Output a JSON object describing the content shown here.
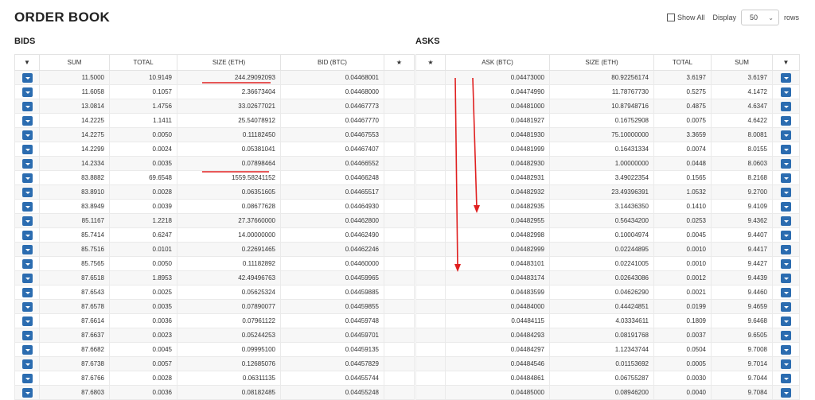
{
  "header": {
    "title": "ORDER BOOK"
  },
  "controls": {
    "show_all_label": "Show All",
    "display_label": "Display",
    "rows_value": "50",
    "rows_label": "rows"
  },
  "bids": {
    "title": "BIDS",
    "columns": [
      "▼",
      "SUM",
      "TOTAL",
      "SIZE (ETH)",
      "BID (BTC)",
      "★"
    ],
    "rows": [
      [
        "11.5000",
        "10.9149",
        "244.29092093",
        "0.04468001"
      ],
      [
        "11.6058",
        "0.1057",
        "2.36673404",
        "0.04468000"
      ],
      [
        "13.0814",
        "1.4756",
        "33.02677021",
        "0.04467773"
      ],
      [
        "14.2225",
        "1.1411",
        "25.54078912",
        "0.04467770"
      ],
      [
        "14.2275",
        "0.0050",
        "0.11182450",
        "0.04467553"
      ],
      [
        "14.2299",
        "0.0024",
        "0.05381041",
        "0.04467407"
      ],
      [
        "14.2334",
        "0.0035",
        "0.07898464",
        "0.04466552"
      ],
      [
        "83.8882",
        "69.6548",
        "1559.58241152",
        "0.04466248"
      ],
      [
        "83.8910",
        "0.0028",
        "0.06351605",
        "0.04465517"
      ],
      [
        "83.8949",
        "0.0039",
        "0.08677628",
        "0.04464930"
      ],
      [
        "85.1167",
        "1.2218",
        "27.37660000",
        "0.04462800"
      ],
      [
        "85.7414",
        "0.6247",
        "14.00000000",
        "0.04462490"
      ],
      [
        "85.7516",
        "0.0101",
        "0.22691465",
        "0.04462246"
      ],
      [
        "85.7565",
        "0.0050",
        "0.11182892",
        "0.04460000"
      ],
      [
        "87.6518",
        "1.8953",
        "42.49496763",
        "0.04459965"
      ],
      [
        "87.6543",
        "0.0025",
        "0.05625324",
        "0.04459885"
      ],
      [
        "87.6578",
        "0.0035",
        "0.07890077",
        "0.04459855"
      ],
      [
        "87.6614",
        "0.0036",
        "0.07961122",
        "0.04459748"
      ],
      [
        "87.6637",
        "0.0023",
        "0.05244253",
        "0.04459701"
      ],
      [
        "87.6682",
        "0.0045",
        "0.09995100",
        "0.04459135"
      ],
      [
        "87.6738",
        "0.0057",
        "0.12685076",
        "0.04457829"
      ],
      [
        "87.6766",
        "0.0028",
        "0.06311135",
        "0.04455744"
      ],
      [
        "87.6803",
        "0.0036",
        "0.08182485",
        "0.04455248"
      ]
    ]
  },
  "asks": {
    "title": "ASKS",
    "columns": [
      "★",
      "ASK (BTC)",
      "SIZE (ETH)",
      "TOTAL",
      "SUM",
      "▼"
    ],
    "rows": [
      [
        "0.04473000",
        "80.92256174",
        "3.6197",
        "3.6197"
      ],
      [
        "0.04474990",
        "11.78767730",
        "0.5275",
        "4.1472"
      ],
      [
        "0.04481000",
        "10.87948716",
        "0.4875",
        "4.6347"
      ],
      [
        "0.04481927",
        "0.16752908",
        "0.0075",
        "4.6422"
      ],
      [
        "0.04481930",
        "75.10000000",
        "3.3659",
        "8.0081"
      ],
      [
        "0.04481999",
        "0.16431334",
        "0.0074",
        "8.0155"
      ],
      [
        "0.04482930",
        "1.00000000",
        "0.0448",
        "8.0603"
      ],
      [
        "0.04482931",
        "3.49022354",
        "0.1565",
        "8.2168"
      ],
      [
        "0.04482932",
        "23.49396391",
        "1.0532",
        "9.2700"
      ],
      [
        "0.04482935",
        "3.14436350",
        "0.1410",
        "9.4109"
      ],
      [
        "0.04482955",
        "0.56434200",
        "0.0253",
        "9.4362"
      ],
      [
        "0.04482998",
        "0.10004974",
        "0.0045",
        "9.4407"
      ],
      [
        "0.04482999",
        "0.02244895",
        "0.0010",
        "9.4417"
      ],
      [
        "0.04483101",
        "0.02241005",
        "0.0010",
        "9.4427"
      ],
      [
        "0.04483174",
        "0.02643086",
        "0.0012",
        "9.4439"
      ],
      [
        "0.04483599",
        "0.04626290",
        "0.0021",
        "9.4460"
      ],
      [
        "0.04484000",
        "0.44424851",
        "0.0199",
        "9.4659"
      ],
      [
        "0.04484115",
        "4.03334611",
        "0.1809",
        "9.6468"
      ],
      [
        "0.04484293",
        "0.08191768",
        "0.0037",
        "9.6505"
      ],
      [
        "0.04484297",
        "1.12343744",
        "0.0504",
        "9.7008"
      ],
      [
        "0.04484546",
        "0.01153692",
        "0.0005",
        "9.7014"
      ],
      [
        "0.04484861",
        "0.06755287",
        "0.0030",
        "9.7044"
      ],
      [
        "0.04485000",
        "0.08946200",
        "0.0040",
        "9.7084"
      ]
    ]
  },
  "colors": {
    "button_blue": "#2b6cb0",
    "annotation_red": "#e02020"
  }
}
